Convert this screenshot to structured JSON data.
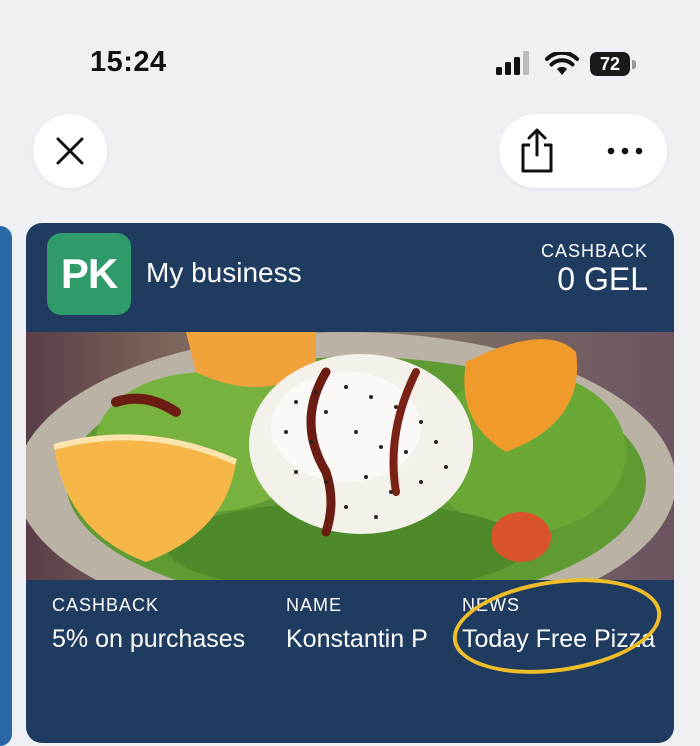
{
  "status_bar": {
    "time": "15:24",
    "battery": "72",
    "icons": [
      "cellular-signal-icon",
      "wifi-icon",
      "battery-icon"
    ]
  },
  "toolbar": {
    "close_icon": "close-icon",
    "share_icon": "share-icon",
    "more_icon": "more-icon"
  },
  "card": {
    "logo": "PK",
    "business_name": "My business",
    "header": {
      "cashback_label": "CASHBACK",
      "cashback_value": "0 GEL"
    },
    "fields": [
      {
        "label": "CASHBACK",
        "value": "5% on purchases"
      },
      {
        "label": "NAME",
        "value": "Konstantin P"
      },
      {
        "label": "NEWS",
        "value": "Today Free Pizza"
      }
    ]
  },
  "colors": {
    "card_background": "#1f3b5f",
    "logo_background": "#2f9a6a",
    "highlight": "#f0bd2a",
    "page_background": "#eef0f3"
  }
}
